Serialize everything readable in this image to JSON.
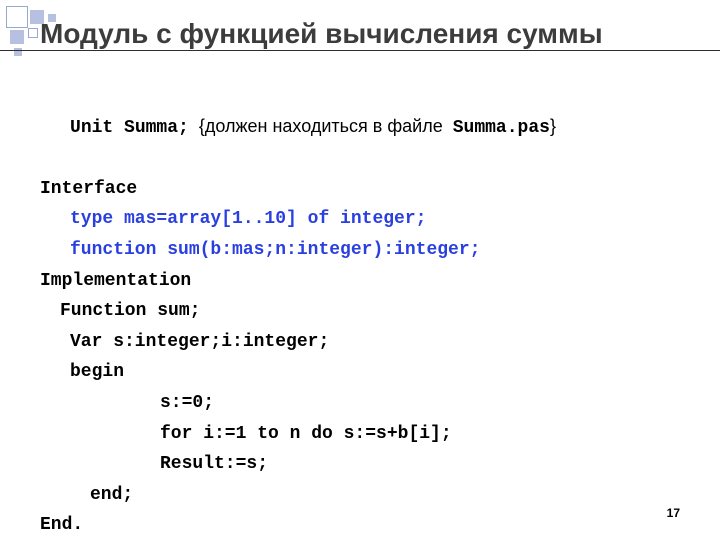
{
  "title": "Модуль с функцией вычисления суммы",
  "code": {
    "l1a": "Unit Summa;",
    "l1b": "  {должен находиться в файле  ",
    "l1c": "Summa.pas",
    "l1d": "}",
    "l2": "Interface",
    "l3": "type mas=array[1..10] of integer;",
    "l4": "function sum(b:mas;n:integer):integer;",
    "l5": "Implementation",
    "l6": "Function sum;",
    "l7": "Var s:integer;i:integer;",
    "l8": "begin",
    "l9": "s:=0;",
    "l10": "for i:=1 to n do s:=s+b[i];",
    "l11": "Result:=s;",
    "l12": "end;",
    "l13": "End."
  },
  "page_number": "17"
}
